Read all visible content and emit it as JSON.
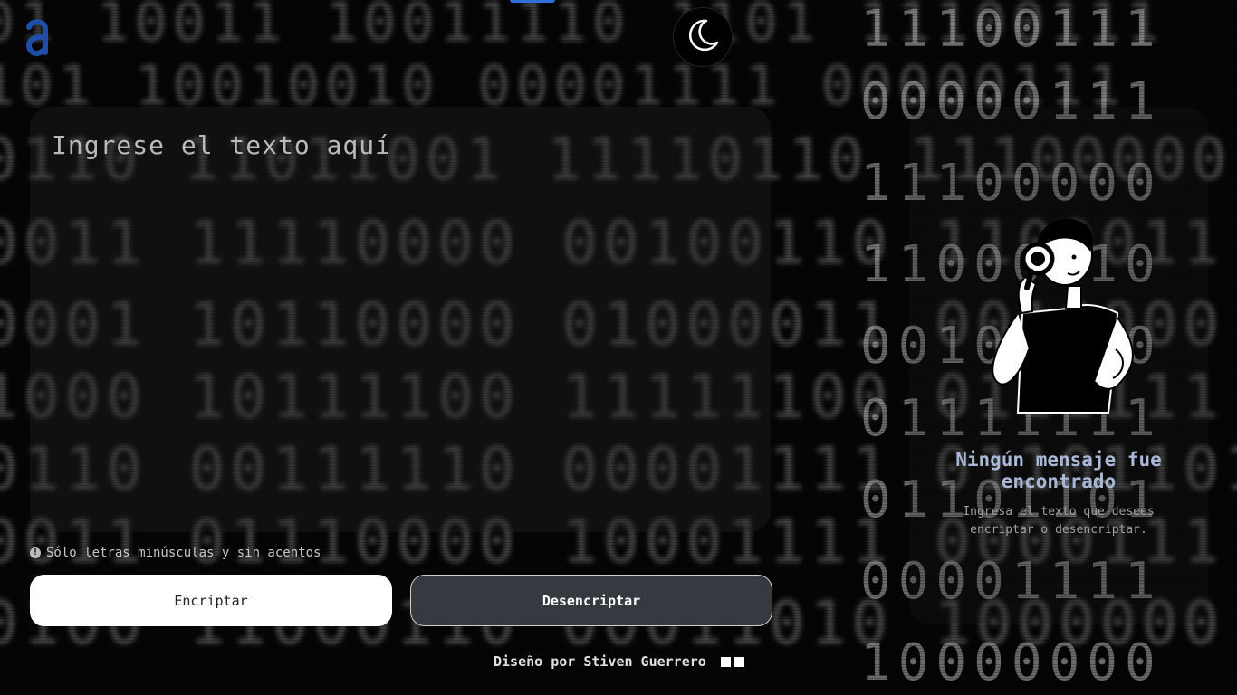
{
  "header": {
    "theme_toggle_icon": "moon-icon",
    "logo_icon": "alura-logo-icon"
  },
  "input": {
    "placeholder": "Ingrese el texto aquí"
  },
  "hint": {
    "text": "Sólo letras minúsculas y sin acentos",
    "icon": "info-icon"
  },
  "buttons": {
    "encrypt_label": "Encriptar",
    "decrypt_label": "Desencriptar"
  },
  "output": {
    "title": "Ningún mensaje fue encontrado",
    "subtitle": "Ingresa el texto que desees encriptar o desencriptar.",
    "illustration": "person-with-magnifier-illustration"
  },
  "footer": {
    "credit": "Diseño por Stiven Guerrero"
  },
  "colors": {
    "accent": "#2f6fd6",
    "title_blue": "#a9b8d6",
    "decrypt_bg": "#343a40"
  }
}
